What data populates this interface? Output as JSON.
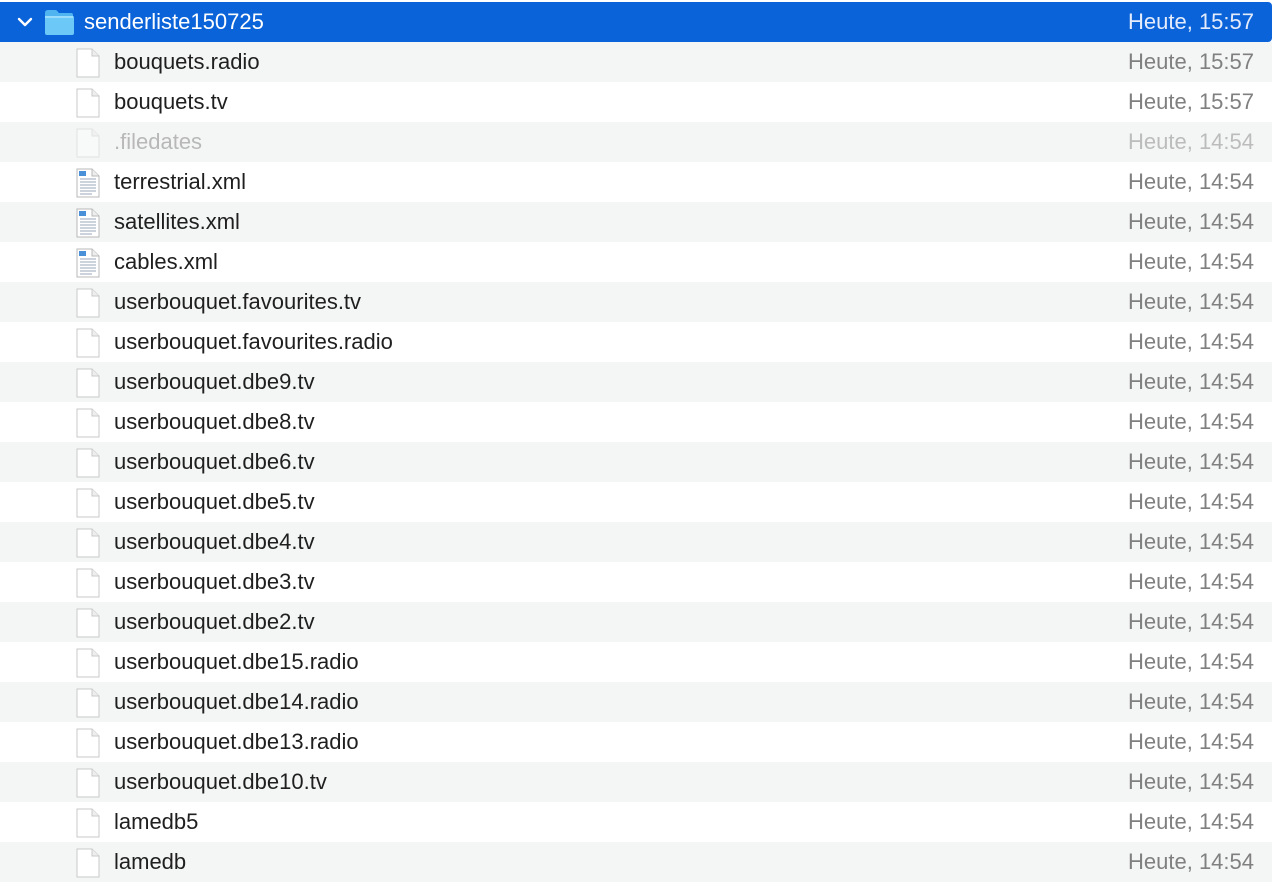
{
  "folder": {
    "name": "senderliste150725",
    "date": "Heute, 15:57",
    "expanded": true,
    "icon": "folder-icon",
    "accent_color": "#0a63d9"
  },
  "files": [
    {
      "name": "bouquets.radio",
      "date": "Heute, 15:57",
      "icon": "generic-document-icon",
      "hidden": false
    },
    {
      "name": "bouquets.tv",
      "date": "Heute, 15:57",
      "icon": "generic-document-icon",
      "hidden": false
    },
    {
      "name": ".filedates",
      "date": "Heute, 14:54",
      "icon": "generic-document-icon",
      "hidden": true
    },
    {
      "name": "terrestrial.xml",
      "date": "Heute, 14:54",
      "icon": "xml-document-icon",
      "hidden": false
    },
    {
      "name": "satellites.xml",
      "date": "Heute, 14:54",
      "icon": "xml-document-icon",
      "hidden": false
    },
    {
      "name": "cables.xml",
      "date": "Heute, 14:54",
      "icon": "xml-document-icon",
      "hidden": false
    },
    {
      "name": "userbouquet.favourites.tv",
      "date": "Heute, 14:54",
      "icon": "generic-document-icon",
      "hidden": false
    },
    {
      "name": "userbouquet.favourites.radio",
      "date": "Heute, 14:54",
      "icon": "generic-document-icon",
      "hidden": false
    },
    {
      "name": "userbouquet.dbe9.tv",
      "date": "Heute, 14:54",
      "icon": "generic-document-icon",
      "hidden": false
    },
    {
      "name": "userbouquet.dbe8.tv",
      "date": "Heute, 14:54",
      "icon": "generic-document-icon",
      "hidden": false
    },
    {
      "name": "userbouquet.dbe6.tv",
      "date": "Heute, 14:54",
      "icon": "generic-document-icon",
      "hidden": false
    },
    {
      "name": "userbouquet.dbe5.tv",
      "date": "Heute, 14:54",
      "icon": "generic-document-icon",
      "hidden": false
    },
    {
      "name": "userbouquet.dbe4.tv",
      "date": "Heute, 14:54",
      "icon": "generic-document-icon",
      "hidden": false
    },
    {
      "name": "userbouquet.dbe3.tv",
      "date": "Heute, 14:54",
      "icon": "generic-document-icon",
      "hidden": false
    },
    {
      "name": "userbouquet.dbe2.tv",
      "date": "Heute, 14:54",
      "icon": "generic-document-icon",
      "hidden": false
    },
    {
      "name": "userbouquet.dbe15.radio",
      "date": "Heute, 14:54",
      "icon": "generic-document-icon",
      "hidden": false
    },
    {
      "name": "userbouquet.dbe14.radio",
      "date": "Heute, 14:54",
      "icon": "generic-document-icon",
      "hidden": false
    },
    {
      "name": "userbouquet.dbe13.radio",
      "date": "Heute, 14:54",
      "icon": "generic-document-icon",
      "hidden": false
    },
    {
      "name": "userbouquet.dbe10.tv",
      "date": "Heute, 14:54",
      "icon": "generic-document-icon",
      "hidden": false
    },
    {
      "name": "lamedb5",
      "date": "Heute, 14:54",
      "icon": "generic-document-icon",
      "hidden": false
    },
    {
      "name": "lamedb",
      "date": "Heute, 14:54",
      "icon": "generic-document-icon",
      "hidden": false
    }
  ]
}
